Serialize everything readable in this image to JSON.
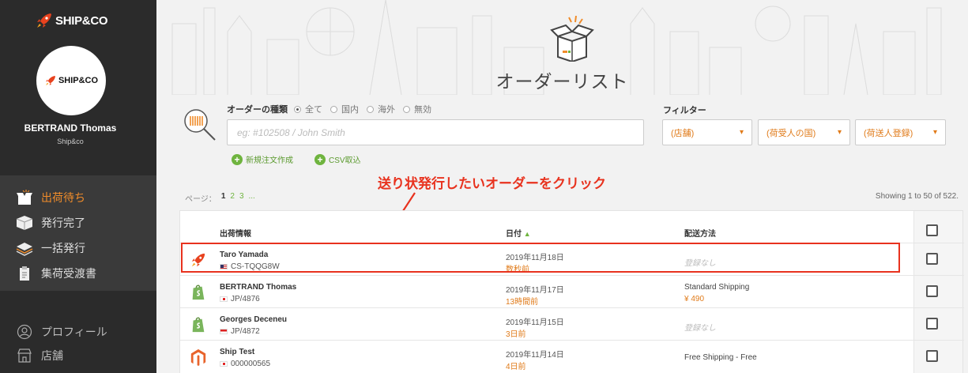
{
  "brand": {
    "logo_text": "SHIP&CO",
    "avatar_text": "SHIP&CO"
  },
  "user": {
    "name": "BERTRAND Thomas",
    "company": "Ship&co"
  },
  "nav": [
    {
      "label": "出荷待ち",
      "icon": "box-open-icon"
    },
    {
      "label": "発行完了",
      "icon": "box-icon"
    },
    {
      "label": "一括発行",
      "icon": "stack-icon"
    },
    {
      "label": "集荷受渡書",
      "icon": "clipboard-icon"
    }
  ],
  "nav_secondary": [
    {
      "label": "プロフィール",
      "icon": "user-icon"
    },
    {
      "label": "店舗",
      "icon": "store-icon"
    }
  ],
  "page": {
    "title": "オーダーリスト"
  },
  "search": {
    "type_label": "オーダーの種類",
    "options": [
      "全て",
      "国内",
      "海外",
      "無効"
    ],
    "selected": "全て",
    "placeholder": "eg: #102508 / John Smith"
  },
  "actions": {
    "new_order": "新規注文作成",
    "csv_import": "CSV取込"
  },
  "filters": {
    "label": "フィルター",
    "store": "(店舗)",
    "recipient_country": "(荷受人の国)",
    "sender": "(荷送人登録)"
  },
  "annotation": "送り状発行したいオーダーをクリック",
  "pagination": {
    "label": "ページ：",
    "pages": [
      "1",
      "2",
      "3",
      "..."
    ],
    "current": "1"
  },
  "showing": "Showing 1 to 50 of 522.",
  "table": {
    "headers": {
      "info": "出荷情報",
      "date": "日付",
      "sort_icon": "▲",
      "method": "配送方法"
    },
    "rows": [
      {
        "name": "Taro Yamada",
        "flag": "us",
        "ref": "CS-TQQG8W",
        "date": "2019年11月18日",
        "ago": "数秒前",
        "method": "登録なし",
        "method_empty": true,
        "price": "",
        "icon": "rocket-icon"
      },
      {
        "name": "BERTRAND Thomas",
        "flag": "jp",
        "ref": "JP/4876",
        "date": "2019年11月17日",
        "ago": "13時間前",
        "method": "Standard Shipping",
        "method_empty": false,
        "price": "¥ 490",
        "icon": "shopify-icon"
      },
      {
        "name": "Georges Deceneu",
        "flag": "sg",
        "ref": "JP/4872",
        "date": "2019年11月15日",
        "ago": "3日前",
        "method": "登録なし",
        "method_empty": true,
        "price": "",
        "icon": "shopify-icon"
      },
      {
        "name": "Ship Test",
        "flag": "jp",
        "ref": "000000565",
        "date": "2019年11月14日",
        "ago": "4日前",
        "method": "Free Shipping - Free",
        "method_empty": false,
        "price": "",
        "icon": "magento-icon"
      }
    ]
  },
  "colors": {
    "accent": "#f08c2a",
    "green": "#6fb43f",
    "annotation_red": "#e8321e",
    "sidebar": "#2b2b2b"
  }
}
